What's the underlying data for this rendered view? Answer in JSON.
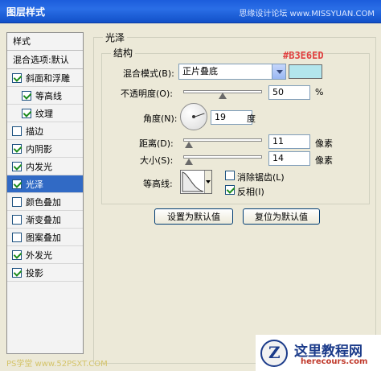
{
  "window": {
    "title": "图层样式",
    "watermark_top": "思缘设计论坛 www.MISSYUAN.COM"
  },
  "sidebar": {
    "header": "样式",
    "blend_options": "混合选项:默认",
    "items": [
      {
        "label": "斜面和浮雕",
        "checked": true,
        "sub": false,
        "selected": false
      },
      {
        "label": "等高线",
        "checked": true,
        "sub": true,
        "selected": false
      },
      {
        "label": "纹理",
        "checked": true,
        "sub": true,
        "selected": false
      },
      {
        "label": "描边",
        "checked": false,
        "sub": false,
        "selected": false
      },
      {
        "label": "内阴影",
        "checked": true,
        "sub": false,
        "selected": false
      },
      {
        "label": "内发光",
        "checked": true,
        "sub": false,
        "selected": false
      },
      {
        "label": "光泽",
        "checked": true,
        "sub": false,
        "selected": true
      },
      {
        "label": "颜色叠加",
        "checked": false,
        "sub": false,
        "selected": false
      },
      {
        "label": "渐变叠加",
        "checked": false,
        "sub": false,
        "selected": false
      },
      {
        "label": "图案叠加",
        "checked": false,
        "sub": false,
        "selected": false
      },
      {
        "label": "外发光",
        "checked": true,
        "sub": false,
        "selected": false
      },
      {
        "label": "投影",
        "checked": true,
        "sub": false,
        "selected": false
      }
    ]
  },
  "satin": {
    "title": "光泽",
    "structure_title": "结构",
    "blend_mode_label": "混合模式(B):",
    "blend_mode_value": "正片叠底",
    "color_hex": "#B3E6ED",
    "color_swatch": "#b3e6ed",
    "opacity_label": "不透明度(O):",
    "opacity_value": "50",
    "opacity_unit": "%",
    "opacity_fraction": 0.5,
    "angle_label": "角度(N):",
    "angle_value": "19",
    "angle_unit": "度",
    "distance_label": "距离(D):",
    "distance_value": "11",
    "distance_unit": "像素",
    "size_label": "大小(S):",
    "size_value": "14",
    "size_unit": "像素",
    "contour_label": "等高线:",
    "antialias_label": "消除锯齿(L)",
    "antialias_checked": false,
    "invert_label": "反相(I)",
    "invert_checked": true,
    "make_default_button": "设置为默认值",
    "reset_default_button": "复位为默认值"
  },
  "footer": {
    "watermark_left": "PS学堂 www.52PSXT.COM",
    "logo_brand": "这里教程网",
    "logo_site": "herecours.com"
  },
  "colors": {
    "title_bar": "#1c5ddc",
    "selection": "#316ac5",
    "hex_text": "#e04040"
  }
}
